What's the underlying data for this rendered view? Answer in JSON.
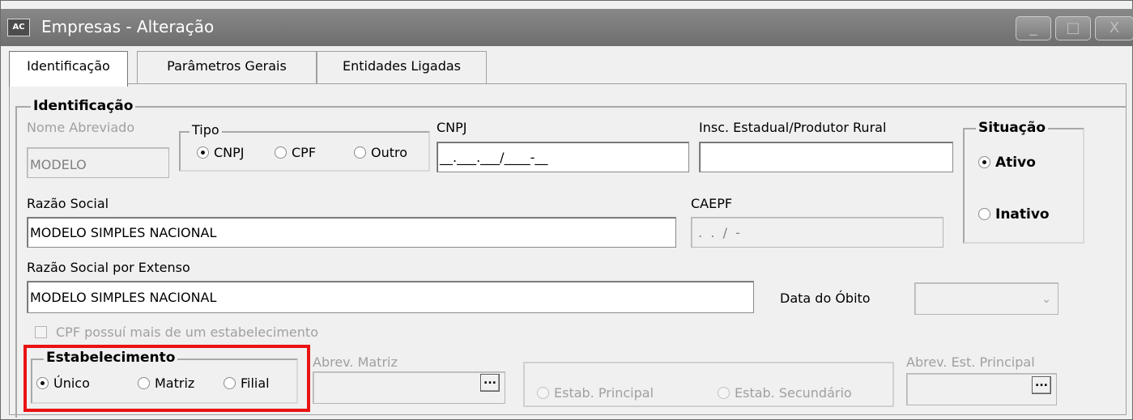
{
  "window": {
    "app_icon_text": "AC",
    "title": "Empresas - Alteração",
    "controls": {
      "minimize": "_",
      "maximize": "□",
      "close": "X"
    }
  },
  "tabs": [
    "Identificação",
    "Parâmetros Gerais",
    "Entidades Ligadas"
  ],
  "identificacao": {
    "legend": "Identificação",
    "nome_abreviado": {
      "label": "Nome Abreviado",
      "value": "MODELO"
    },
    "tipo": {
      "legend": "Tipo",
      "options": [
        "CNPJ",
        "CPF",
        "Outro"
      ],
      "selected": "CNPJ"
    },
    "cnpj": {
      "label": "CNPJ",
      "value": "__.___.___/____-__"
    },
    "insc_estadual": {
      "label": "Insc. Estadual/Produtor Rural",
      "value": ""
    },
    "situacao": {
      "legend": "Situação",
      "options": [
        "Ativo",
        "Inativo"
      ],
      "selected": "Ativo"
    },
    "razao_social": {
      "label": "Razão Social",
      "value": "MODELO SIMPLES NACIONAL"
    },
    "caepf": {
      "label": "CAEPF",
      "value": " .  .  /  -"
    },
    "razao_social_extenso": {
      "label": "Razão Social por Extenso",
      "value": "MODELO SIMPLES NACIONAL"
    },
    "data_obito": {
      "label": "Data do Óbito",
      "value": ""
    },
    "cpf_estab": {
      "label": "CPF possuí mais de um estabelecimento",
      "checked": false
    },
    "estabelecimento": {
      "legend": "Estabelecimento",
      "options": [
        "Único",
        "Matriz",
        "Filial"
      ],
      "selected": "Único"
    },
    "abrev_matriz": {
      "label": "Abrev. Matriz",
      "value": "",
      "button": "..."
    },
    "estab_tipo": {
      "options": [
        "Estab. Principal",
        "Estab. Secundário"
      ]
    },
    "abrev_est_principal": {
      "label": "Abrev. Est. Principal",
      "value": "",
      "button": "..."
    }
  },
  "colors": {
    "highlight": "#e81313",
    "titlebar": "#7a7a7a",
    "disabled_text": "#a0a0a0"
  }
}
